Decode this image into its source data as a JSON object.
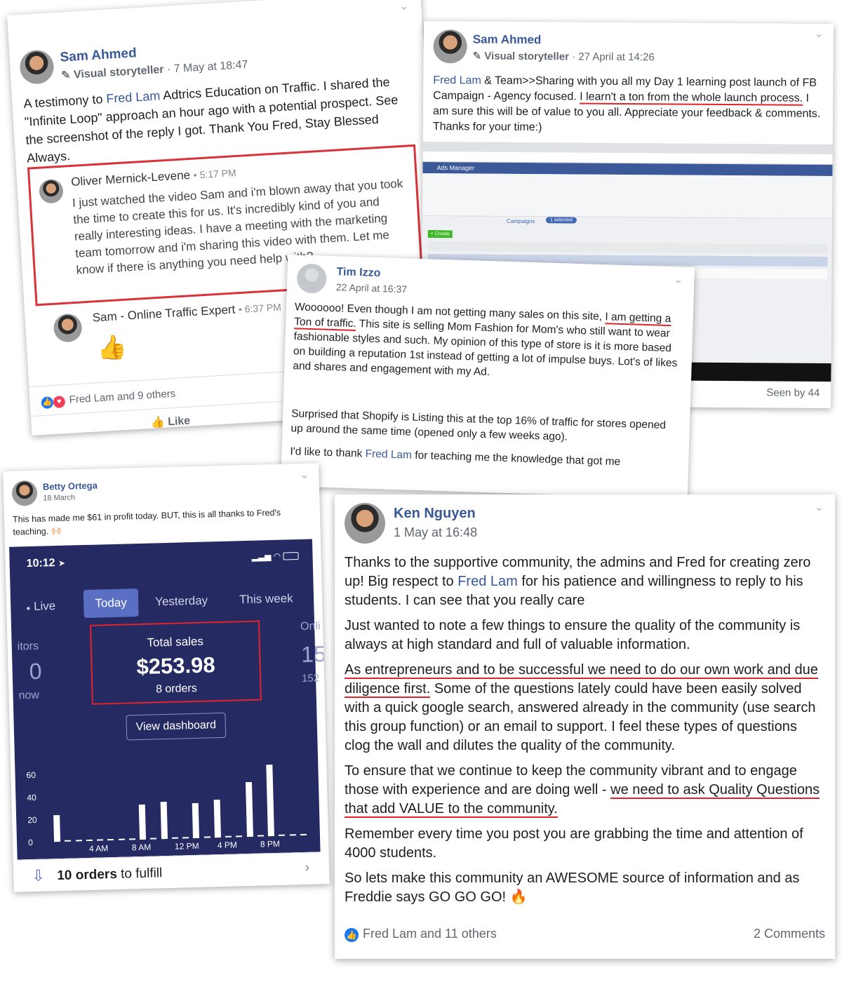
{
  "post1": {
    "author": "Sam Ahmed",
    "badge": "Visual storyteller",
    "time": "· 7 May at 18:47",
    "text_before": "A testimony to ",
    "link": "Fred Lam",
    "text_after": " Adtrics Education on Traffic. I shared the \"Infinite Loop\" approach an hour ago with a potential prospect. See the screenshot of the reply I got. Thank You Fred, Stay Blessed Always.",
    "comment_author": "Oliver Mernick-Levene",
    "comment_time": "• 5:17 PM",
    "comment_text": "I just watched the video Sam and i'm blown away that you took the time to create this for us. It's incredibly kind of you and really interesting ideas. I have a meeting with the marketing team tomorrow and i'm sharing this video with them. Let me know if there is anything you need help with?",
    "reply_author": "Sam - Online Traffic Expert",
    "reply_time": "• 6:37 PM",
    "reply_emoji": "👍",
    "reactions": "Fred Lam and 9 others",
    "like_label": "Like"
  },
  "post2": {
    "author": "Sam Ahmed",
    "badge": "Visual storyteller",
    "time": "· 27 April at 14:26",
    "link": "Fred Lam",
    "text_a": " & Team>>Sharing with you all my Day 1 learning post launch of FB Campaign - Agency focused. ",
    "text_underlined": "I learn't a ton from the whole launch process.",
    "text_b": " I am sure this will be of value to you all. Appreciate your feedback & comments. Thanks for your time:)",
    "screenshot_title": "Ads Manager",
    "screenshot_tab": "Campaigns",
    "screenshot_selected": "1 selected",
    "screenshot_create": "+ Create",
    "seen": "Seen by 44"
  },
  "post3": {
    "author": "Tim Izzo",
    "time": "22 April at 16:37",
    "p1_a": "Woooooo! Even though I am not getting many sales on this site, ",
    "p1_ul": "I am getting a Ton of traffic.",
    "p1_b": " This site is selling Mom Fashion for Mom's who still want to wear fashionable styles and such. My opinion of this type of store is it is more based on building a reputation 1st instead of getting a lot of impulse buys. Lot's of likes and shares and engagement with my Ad.",
    "p2": "Surprised that Shopify is Listing this at the top 16% of traffic for stores opened up around the same time (opened only a few weeks ago).",
    "p3_a": "I'd like to thank ",
    "p3_link": "Fred Lam",
    "p3_b": " for teaching me the knowledge that got me"
  },
  "post4": {
    "author": "Betty Ortega",
    "time": "18 March",
    "text": "This has made me $61 in profit today. BUT, this is all thanks to Fred's teaching. 🙌🏻",
    "phone": {
      "clock": "10:12",
      "tabs": [
        "Live",
        "Today",
        "Yesterday",
        "This week"
      ],
      "active_tab": "Today",
      "total_sales_label": "Total sales",
      "total_sales_value": "$253.98",
      "orders": "8 orders",
      "left_label_1": "itors",
      "left_value": "0",
      "left_label_2": "now",
      "right_label": "Onli",
      "right_value": "15",
      "right_sub": "152",
      "dashboard_button": "View dashboard",
      "fulfill_count": "10 orders",
      "fulfill_suffix": " to fulfill"
    }
  },
  "chart_data": {
    "type": "bar",
    "categories": [
      "12 AM",
      "1 AM",
      "2 AM",
      "3 AM",
      "4 AM",
      "5 AM",
      "6 AM",
      "7 AM",
      "8 AM",
      "9 AM",
      "10 AM",
      "11 AM",
      "12 PM",
      "1 PM",
      "2 PM",
      "3 PM",
      "4 PM",
      "5 PM",
      "6 PM",
      "7 PM",
      "8 PM",
      "9 PM",
      "10 PM",
      "11 PM"
    ],
    "values": [
      24,
      0,
      0,
      0,
      0,
      0,
      0,
      0,
      31,
      0,
      33,
      0,
      0,
      31,
      0,
      34,
      0,
      0,
      49,
      0,
      64,
      0,
      0,
      0
    ],
    "xticks": [
      "4 AM",
      "8 AM",
      "12 PM",
      "4 PM",
      "8 PM"
    ],
    "yticks": [
      "0",
      "20",
      "40",
      "60"
    ],
    "ylim": [
      0,
      70
    ]
  },
  "post5": {
    "author": "Ken Nguyen",
    "time": "1 May at 16:48",
    "p1_a": "Thanks to the supportive community, the admins and Fred for creating zero up! Big respect to ",
    "p1_link": "Fred Lam",
    "p1_b": " for his patience and willingness to reply to his students. I can see that you really care",
    "p2": "Just wanted to note a few things to ensure the quality of the community is always at high standard and full of valuable information.",
    "p3_ul": "As entrepreneurs and to be successful we need to do our own work and due diligence first.",
    "p3_b": " Some of the questions lately could have been easily solved with a quick google search, answered already in the community (use search this group function) or an email to support. I feel these types of questions clog the wall and dilutes the quality of the community.",
    "p4_a": "To ensure that we continue to keep the community vibrant and to engage those with experience and are doing well - ",
    "p4_ul": "we need to ask Quality Questions that add VALUE to the community.",
    "p5": "Remember every time you post you are grabbing the time and attention of 4000 students.",
    "p6": "So lets make this community an AWESOME source of information and as Freddie says GO GO GO! 🔥",
    "reactions": "Fred Lam and 11 others",
    "comments": "2 Comments"
  }
}
